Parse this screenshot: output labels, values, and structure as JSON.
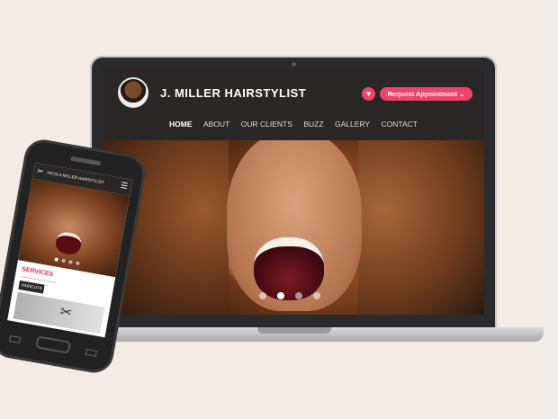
{
  "site": {
    "brand": "J. MILLER HAIRSTYLIST",
    "appointment_button": "Request Appointment",
    "appointment_chevron": "⌄",
    "nav": [
      {
        "label": "HOME",
        "active": true
      },
      {
        "label": "ABOUT",
        "active": false
      },
      {
        "label": "OUR CLIENTS",
        "active": false
      },
      {
        "label": "BUZZ",
        "active": false
      },
      {
        "label": "GALLERY",
        "active": false
      },
      {
        "label": "CONTACT",
        "active": false
      }
    ],
    "slider_dots": 4,
    "slider_active_index": 1
  },
  "phone": {
    "brand": "NICOLA MILLER HAIRSTYLIST",
    "section_title": "SERVICES",
    "category_tab": "HAIRCUTS",
    "slider_dots": 4,
    "slider_active_index": 0
  },
  "colors": {
    "accent": "#f0436a",
    "header_bg": "#2c2727",
    "page_bg": "#f3ece6",
    "services_red": "#d8304a"
  },
  "icons": {
    "heart": "heart-icon",
    "menu": "hamburger-menu-icon",
    "logo": "scissors-logo-icon"
  }
}
